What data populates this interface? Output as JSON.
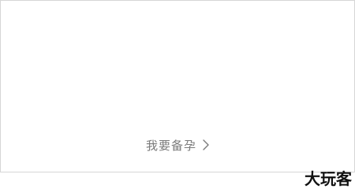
{
  "card": {
    "cta_label": "我要备孕",
    "cta_icon": "chevron-right-icon"
  },
  "watermark": {
    "text": "大玩客"
  }
}
